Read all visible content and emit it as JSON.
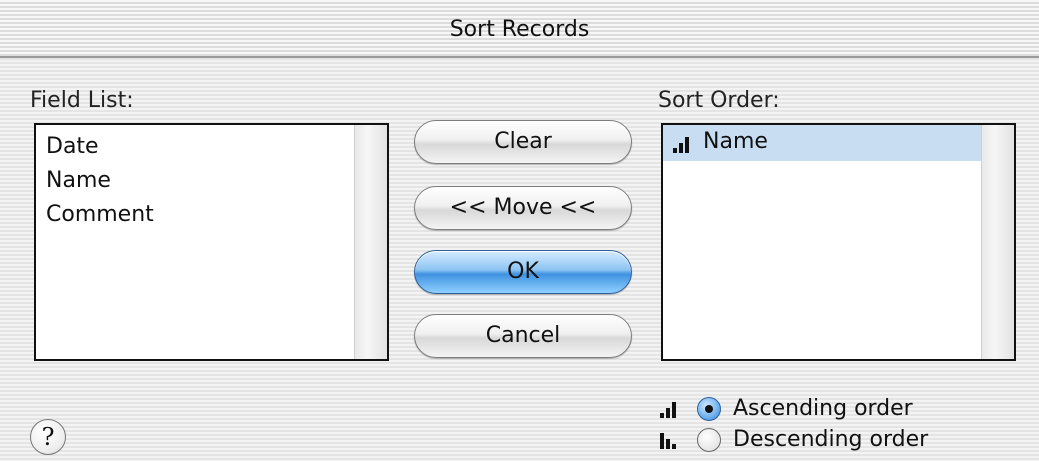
{
  "window": {
    "title": "Sort Records"
  },
  "field_list": {
    "label": "Field List:",
    "items": [
      "Date",
      "Name",
      "Comment"
    ]
  },
  "sort_order": {
    "label": "Sort Order:",
    "items": [
      {
        "name": "Name",
        "order": "ascending",
        "selected": true
      }
    ]
  },
  "buttons": {
    "clear": "Clear",
    "move": "<< Move <<",
    "ok": "OK",
    "cancel": "Cancel"
  },
  "order_options": {
    "ascending": "Ascending order",
    "descending": "Descending order",
    "selected": "ascending"
  },
  "help": {
    "glyph": "?"
  },
  "icons": {
    "ascending": "ascending-bars-icon",
    "descending": "descending-bars-icon",
    "help": "help-icon"
  },
  "colors": {
    "default_button": "#4a9be6",
    "selected_row": "#c8ddf2"
  }
}
